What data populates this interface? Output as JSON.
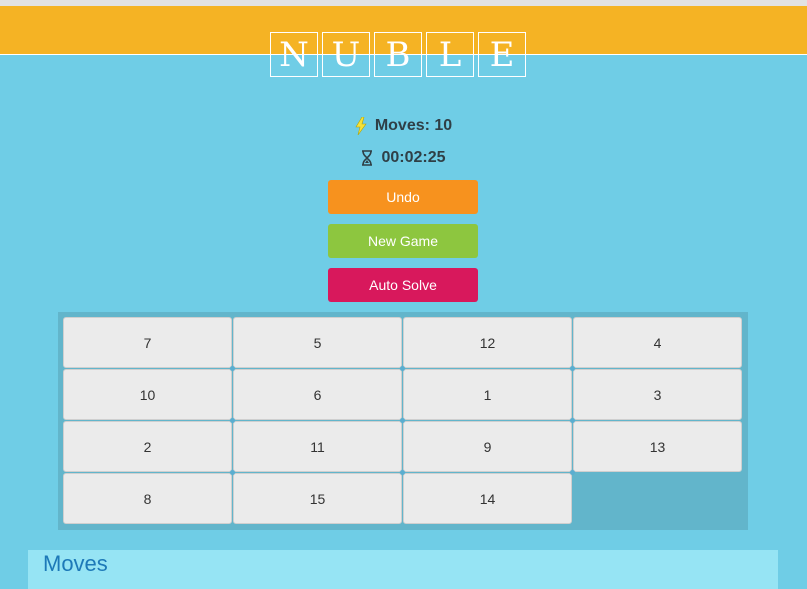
{
  "logo": {
    "letters": [
      "N",
      "U",
      "B",
      "L",
      "E"
    ]
  },
  "stats": {
    "moves_label": "Moves: 10",
    "time": "00:02:25"
  },
  "buttons": {
    "undo": "Undo",
    "new_game": "New Game",
    "auto_solve": "Auto Solve"
  },
  "board": {
    "rows": 4,
    "cols": 4,
    "cells": [
      [
        "7",
        "5",
        "12",
        "4"
      ],
      [
        "10",
        "6",
        "1",
        "3"
      ],
      [
        "2",
        "11",
        "9",
        "13"
      ],
      [
        "8",
        "15",
        "14",
        ""
      ]
    ]
  },
  "moves_panel": {
    "title": "Moves"
  },
  "colors": {
    "background": "#6fcde6",
    "header": "#f5b324",
    "undo": "#f7921e",
    "new_game": "#8dc63f",
    "auto_solve": "#d8185c",
    "board": "#62b5cb",
    "tile": "#ebebeb"
  }
}
